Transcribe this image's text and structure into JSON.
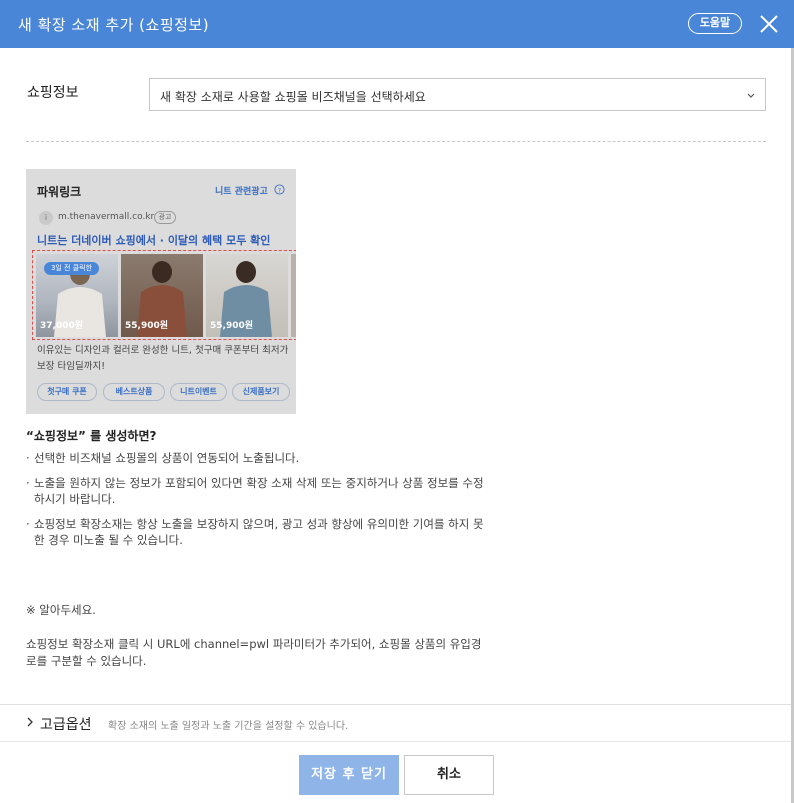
{
  "header": {
    "title": "새 확장 소재 추가 (쇼핑정보)",
    "help_label": "도움말"
  },
  "form": {
    "shop_label": "쇼핑정보",
    "select_value": "새 확장 소재로 사용할 쇼핑몰 비즈채널을 선택하세요"
  },
  "preview": {
    "section_title": "파워링크",
    "related_link": "니트 관련광고",
    "favicon_letter": "i",
    "url": "m.thenavermall.co.kr",
    "ad_badge": "광고",
    "headline": "니트는 더네이버 쇼핑에서 · 이달의 혜택 모두 확인",
    "recent_badge": "3일 전 클릭한",
    "products": [
      {
        "price": "37,000원"
      },
      {
        "price": "55,900원"
      },
      {
        "price": "55,900원"
      }
    ],
    "description": "이유있는 디자인과 컬러로 완성한 니트, 첫구매 쿠폰부터 최저가보장 타임딜까지!",
    "chips": [
      "첫구매 쿠폰",
      "베스트상품",
      "니트이벤트",
      "신제품보기"
    ]
  },
  "info": {
    "heading": "“쇼핑정보” 를 생성하면?",
    "bullets": [
      "선택한 비즈채널 쇼핑몰의 상품이 연동되어 노출됩니다.",
      "노출을 원하지 않는 정보가 포함되어 있다면 확장 소재 삭제 또는 중지하거나 상품 정보를 수정하시기 바랍니다.",
      "쇼핑정보 확장소재는 항상 노출을 보장하지 않으며, 광고 성과 향상에 유의미한 기여를 하지 못한 경우 미노출 될 수 있습니다."
    ],
    "notice_title": "※ 알아두세요.",
    "notice_body": "쇼핑정보 확장소재 클릭 시 URL에 channel=pwl 파라미터가 추가되어, 쇼핑몰 상품의 유입경로를 구분할 수 있습니다."
  },
  "advanced": {
    "label": "고급옵션",
    "hint": "확장 소재의 노출 일정과 노출 기간을 설정할 수 있습니다."
  },
  "footer": {
    "save_label": "저장 후 닫기",
    "cancel_label": "취소"
  },
  "colors": {
    "header_bg": "#4a86d8",
    "link_blue": "#2d5bb8",
    "save_bg": "#8fb4e8",
    "highlight_red": "#e24b4b"
  }
}
